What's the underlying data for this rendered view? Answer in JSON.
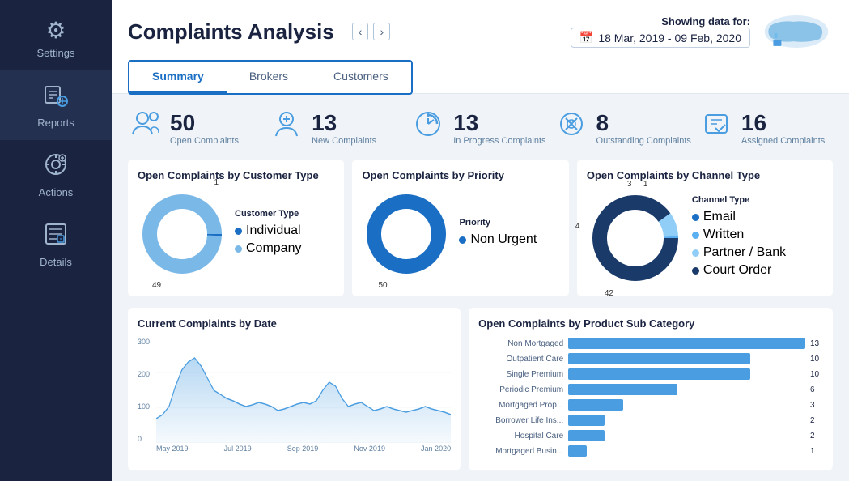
{
  "sidebar": {
    "items": [
      {
        "label": "Settings",
        "icon": "⚙"
      },
      {
        "label": "Reports",
        "icon": "📊"
      },
      {
        "label": "Actions",
        "icon": "⚡"
      },
      {
        "label": "Details",
        "icon": "📋"
      }
    ]
  },
  "header": {
    "title": "Complaints Analysis",
    "tabs": [
      "Summary",
      "Brokers",
      "Customers"
    ],
    "active_tab": "Summary",
    "showing_label": "Showing data for:",
    "date_range": "18 Mar, 2019 - 09 Feb, 2020"
  },
  "stats": [
    {
      "number": "50",
      "label": "Open Complaints"
    },
    {
      "number": "13",
      "label": "New Complaints"
    },
    {
      "number": "13",
      "label": "In Progress Complaints"
    },
    {
      "number": "8",
      "label": "Outstanding Complaints"
    },
    {
      "number": "16",
      "label": "Assigned Complaints"
    }
  ],
  "donut_charts": {
    "customer_type": {
      "title": "Open Complaints by Customer Type",
      "label_top": "1",
      "label_bottom": "49",
      "legend": [
        {
          "label": "Individual",
          "color": "dot-blue"
        },
        {
          "label": "Company",
          "color": "dot-lightblue"
        }
      ],
      "legend_title": "Customer Type"
    },
    "priority": {
      "title": "Open Complaints by Priority",
      "label_bottom": "50",
      "legend": [
        {
          "label": "Non Urgent",
          "color": "dot-blue"
        }
      ],
      "legend_title": "Priority"
    },
    "channel": {
      "title": "Open Complaints by Channel Type",
      "label_top_left": "3",
      "label_top_right": "1",
      "label_left": "4",
      "label_bottom": "42",
      "legend": [
        {
          "label": "Email",
          "color": "dot-email"
        },
        {
          "label": "Written",
          "color": "dot-written"
        },
        {
          "label": "Partner / Bank",
          "color": "dot-partner"
        },
        {
          "label": "Court Order",
          "color": "dot-court"
        }
      ],
      "legend_title": "Channel Type"
    }
  },
  "line_chart": {
    "title": "Current Complaints by Date",
    "y_labels": [
      "300",
      "200",
      "100",
      "0"
    ],
    "x_labels": [
      "May 2019",
      "Jul 2019",
      "Sep 2019",
      "Nov 2019",
      "Jan 2020"
    ]
  },
  "bar_chart": {
    "title": "Open Complaints by Product Sub Category",
    "bars": [
      {
        "label": "Non Mortgaged",
        "value": 13,
        "max": 13
      },
      {
        "label": "Outpatient Care",
        "value": 10,
        "max": 13
      },
      {
        "label": "Single Premium",
        "value": 10,
        "max": 13
      },
      {
        "label": "Periodic Premium",
        "value": 6,
        "max": 13
      },
      {
        "label": "Mortgaged Prop...",
        "value": 3,
        "max": 13
      },
      {
        "label": "Borrower Life Ins...",
        "value": 2,
        "max": 13
      },
      {
        "label": "Hospital Care",
        "value": 2,
        "max": 13
      },
      {
        "label": "Mortgaged Busin...",
        "value": 1,
        "max": 13
      }
    ]
  }
}
